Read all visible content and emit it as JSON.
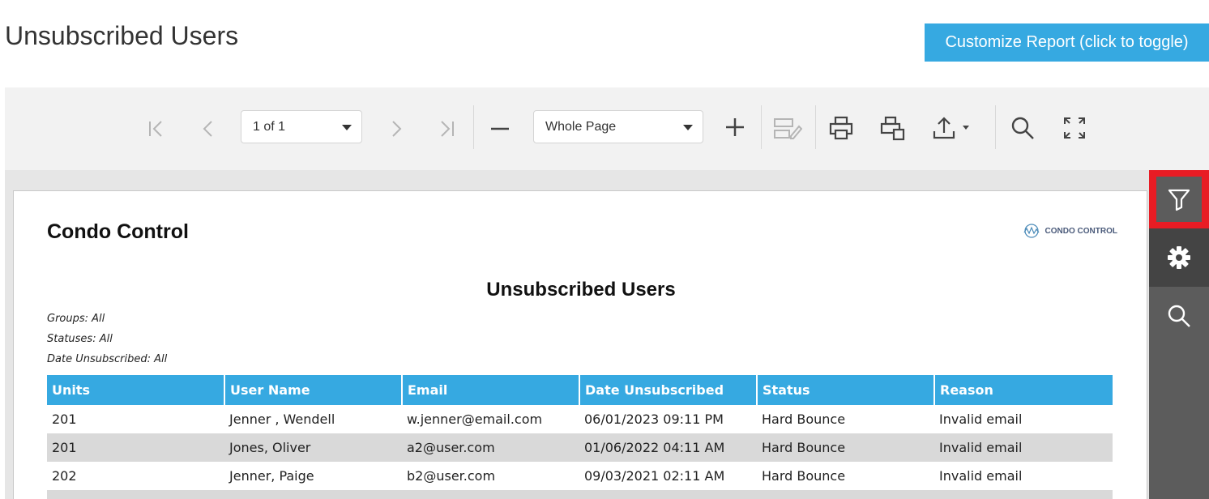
{
  "page": {
    "title": "Unsubscribed Users"
  },
  "customize_button": {
    "label": "Customize Report (click to toggle)"
  },
  "toolbar": {
    "page_selector": "1 of 1",
    "zoom_selector": "Whole Page"
  },
  "report": {
    "company": "Condo Control",
    "logo_text": "CONDO CONTROL",
    "title": "Unsubscribed Users",
    "filters": [
      "Groups: All",
      "Statuses: All",
      "Date Unsubscribed: All"
    ],
    "columns": [
      "Units",
      "User Name",
      "Email",
      "Date Unsubscribed",
      "Status",
      "Reason"
    ],
    "rows": [
      [
        "201",
        "Jenner , Wendell",
        "w.jenner@email.com",
        "06/01/2023 09:11 PM",
        "Hard Bounce",
        "Invalid email"
      ],
      [
        "201",
        "Jones, Oliver",
        "a2@user.com",
        "01/06/2022 04:11 AM",
        "Hard Bounce",
        "Invalid email"
      ],
      [
        "202",
        "Jenner, Paige",
        "b2@user.com",
        "09/03/2021 02:11 AM",
        "Hard Bounce",
        "Invalid email"
      ]
    ]
  },
  "colors": {
    "accent": "#36a9e1",
    "highlight": "#e81c24",
    "side_panel": "#5c5c5c",
    "row_alt": "#d9d9d9"
  }
}
